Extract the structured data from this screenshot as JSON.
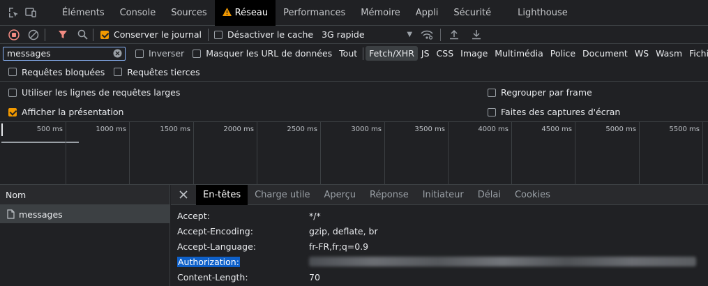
{
  "tabs": [
    {
      "label": "Éléments"
    },
    {
      "label": "Console"
    },
    {
      "label": "Sources"
    },
    {
      "label": "Réseau",
      "active": true
    },
    {
      "label": "Performances"
    },
    {
      "label": "Mémoire"
    },
    {
      "label": "Appli"
    },
    {
      "label": "Sécurité"
    },
    {
      "label": "Lighthouse"
    }
  ],
  "toolbar": {
    "preserve_log": "Conserver le journal",
    "preserve_log_checked": true,
    "disable_cache": "Désactiver le cache",
    "disable_cache_checked": false,
    "throttling": "3G rapide"
  },
  "filter": {
    "value": "messages",
    "invert": "Inverser",
    "hide_data_urls": "Masquer les URL de données",
    "types": [
      "Tout",
      "Fetch/XHR",
      "JS",
      "CSS",
      "Image",
      "Multimédia",
      "Police",
      "Document",
      "WS",
      "Wasm",
      "Fichier"
    ],
    "active_type": "Fetch/XHR"
  },
  "block": {
    "blocked_requests": "Requêtes bloquées",
    "third_party": "Requêtes tierces"
  },
  "settings": {
    "large_rows": "Utiliser les lignes de requêtes larges",
    "large_rows_checked": false,
    "overview": "Afficher la présentation",
    "overview_checked": true,
    "group_by_frame": "Regrouper par frame",
    "group_by_frame_checked": false,
    "screenshots": "Faites des captures d'écran",
    "screenshots_checked": false
  },
  "timeline": {
    "ticks": [
      "500 ms",
      "1000 ms",
      "1500 ms",
      "2000 ms",
      "2500 ms",
      "3000 ms",
      "3500 ms",
      "4000 ms",
      "4500 ms",
      "5000 ms",
      "5500 ms"
    ]
  },
  "requests": {
    "column_name": "Nom",
    "items": [
      {
        "name": "messages"
      }
    ]
  },
  "details": {
    "tabs": [
      "En-têtes",
      "Charge utile",
      "Aperçu",
      "Réponse",
      "Initiateur",
      "Délai",
      "Cookies"
    ],
    "active_tab": "En-têtes",
    "headers": [
      {
        "name": "Accept:",
        "value": "*/*"
      },
      {
        "name": "Accept-Encoding:",
        "value": "gzip, deflate, br"
      },
      {
        "name": "Accept-Language:",
        "value": "fr-FR,fr;q=0.9"
      },
      {
        "name": "Authorization:",
        "value": ""
      },
      {
        "name": "Content-Length:",
        "value": "70"
      }
    ]
  },
  "colors": {
    "accent": "#f29900",
    "record": "#f28b82",
    "filter_icon": "#f28b82",
    "selection": "#0e60c9"
  }
}
